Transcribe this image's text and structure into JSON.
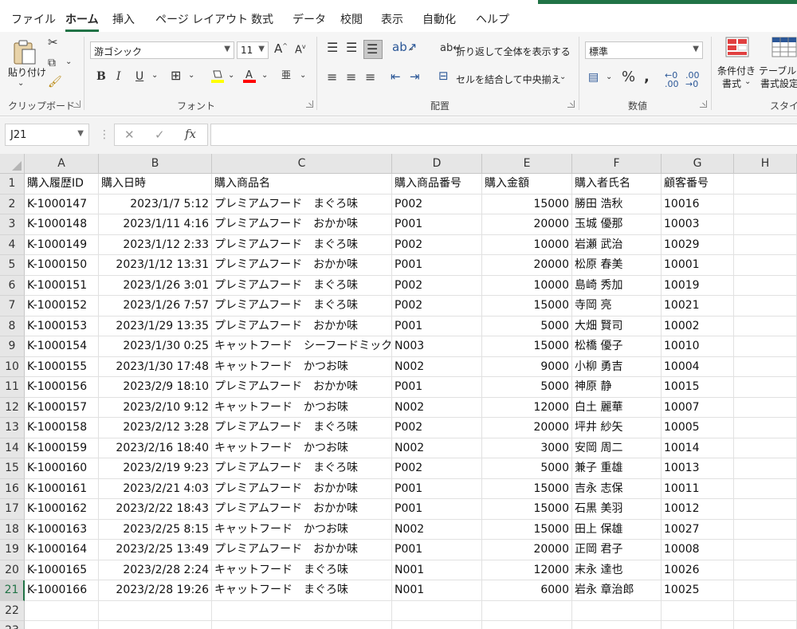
{
  "menu": {
    "tabs": [
      "ファイル",
      "ホーム",
      "挿入",
      "ページ レイアウト",
      "数式",
      "データ",
      "校閲",
      "表示",
      "自動化",
      "ヘルプ"
    ]
  },
  "ribbon": {
    "clipboard": {
      "label": "クリップボード",
      "paste": "貼り付け"
    },
    "font": {
      "label": "フォント",
      "name": "游ゴシック",
      "size": "11",
      "bold": "B",
      "italic": "I",
      "underline": "U"
    },
    "alignment": {
      "label": "配置",
      "wrap": "折り返して全体を表示する",
      "merge": "セルを結合して中央揃え"
    },
    "number": {
      "label": "数値",
      "format": "標準"
    },
    "styles": {
      "label": "スタイル",
      "conditional_line1": "条件付き",
      "conditional_line2": "書式",
      "table_line1": "テーブルと",
      "table_line2": "書式設定"
    }
  },
  "formula_bar": {
    "name_box": "J21",
    "formula": ""
  },
  "sheet": {
    "columns": [
      "A",
      "B",
      "C",
      "D",
      "E",
      "F",
      "G",
      "H"
    ],
    "headers": [
      "購入履歴ID",
      "購入日時",
      "購入商品名",
      "購入商品番号",
      "購入金額",
      "購入者氏名",
      "顧客番号"
    ],
    "rows": [
      [
        "K-1000147",
        "2023/1/7 5:12",
        "プレミアムフード　まぐろ味",
        "P002",
        "15000",
        "勝田 浩秋",
        "10016"
      ],
      [
        "K-1000148",
        "2023/1/11 4:16",
        "プレミアムフード　おかか味",
        "P001",
        "20000",
        "玉城 優那",
        "10003"
      ],
      [
        "K-1000149",
        "2023/1/12 2:33",
        "プレミアムフード　まぐろ味",
        "P002",
        "10000",
        "岩瀬 武治",
        "10029"
      ],
      [
        "K-1000150",
        "2023/1/12 13:31",
        "プレミアムフード　おかか味",
        "P001",
        "20000",
        "松原 春美",
        "10001"
      ],
      [
        "K-1000151",
        "2023/1/26 3:01",
        "プレミアムフード　まぐろ味",
        "P002",
        "10000",
        "島崎 秀加",
        "10019"
      ],
      [
        "K-1000152",
        "2023/1/26 7:57",
        "プレミアムフード　まぐろ味",
        "P002",
        "15000",
        "寺岡 亮",
        "10021"
      ],
      [
        "K-1000153",
        "2023/1/29 13:35",
        "プレミアムフード　おかか味",
        "P001",
        "5000",
        "大畑 賢司",
        "10002"
      ],
      [
        "K-1000154",
        "2023/1/30 0:25",
        "キャットフード　シーフードミックス",
        "N003",
        "15000",
        "松橋 優子",
        "10010"
      ],
      [
        "K-1000155",
        "2023/1/30 17:48",
        "キャットフード　かつお味",
        "N002",
        "9000",
        "小柳 勇吉",
        "10004"
      ],
      [
        "K-1000156",
        "2023/2/9 18:10",
        "プレミアムフード　おかか味",
        "P001",
        "5000",
        "神原 静",
        "10015"
      ],
      [
        "K-1000157",
        "2023/2/10 9:12",
        "キャットフード　かつお味",
        "N002",
        "12000",
        "白土 麗華",
        "10007"
      ],
      [
        "K-1000158",
        "2023/2/12 3:28",
        "プレミアムフード　まぐろ味",
        "P002",
        "20000",
        "坪井 紗矢",
        "10005"
      ],
      [
        "K-1000159",
        "2023/2/16 18:40",
        "キャットフード　かつお味",
        "N002",
        "3000",
        "安岡 周二",
        "10014"
      ],
      [
        "K-1000160",
        "2023/2/19 9:23",
        "プレミアムフード　まぐろ味",
        "P002",
        "5000",
        "兼子 重雄",
        "10013"
      ],
      [
        "K-1000161",
        "2023/2/21 4:03",
        "プレミアムフード　おかか味",
        "P001",
        "15000",
        "吉永 志保",
        "10011"
      ],
      [
        "K-1000162",
        "2023/2/22 18:43",
        "プレミアムフード　おかか味",
        "P001",
        "15000",
        "石黒 美羽",
        "10012"
      ],
      [
        "K-1000163",
        "2023/2/25 8:15",
        "キャットフード　かつお味",
        "N002",
        "15000",
        "田上 保雄",
        "10027"
      ],
      [
        "K-1000164",
        "2023/2/25 13:49",
        "プレミアムフード　おかか味",
        "P001",
        "20000",
        "正岡 君子",
        "10008"
      ],
      [
        "K-1000165",
        "2023/2/28 2:24",
        "キャットフード　まぐろ味",
        "N001",
        "12000",
        "末永 達也",
        "10026"
      ],
      [
        "K-1000166",
        "2023/2/28 19:26",
        "キャットフード　まぐろ味",
        "N001",
        "6000",
        "岩永 章治郎",
        "10025"
      ]
    ],
    "row_numbers": [
      "1",
      "2",
      "3",
      "4",
      "5",
      "6",
      "7",
      "8",
      "9",
      "10",
      "11",
      "12",
      "13",
      "14",
      "15",
      "16",
      "17",
      "18",
      "19",
      "20",
      "21",
      "22",
      "23"
    ]
  }
}
